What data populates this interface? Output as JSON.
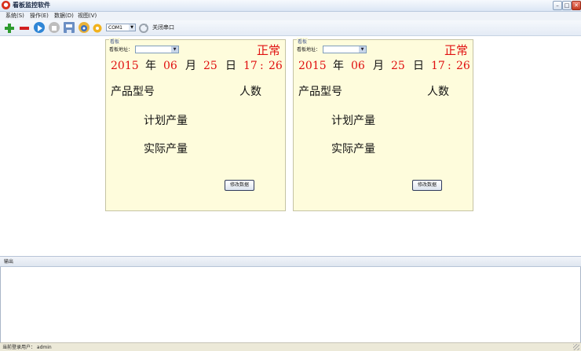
{
  "window": {
    "title": "看板监控软件",
    "app_icon": "app-logo-icon"
  },
  "menu": [
    "系统(S)",
    "操作(E)",
    "数据(D)",
    "视图(V)"
  ],
  "toolbar": {
    "port_value": "COM1",
    "close_port_label": "关闭串口",
    "icons": [
      "add-icon",
      "remove-icon",
      "play-icon",
      "stop-icon",
      "save-icon",
      "compass-icon",
      "settings-icon",
      "refresh-icon"
    ]
  },
  "panels": [
    {
      "header": "看板",
      "address_label": "看板地址：",
      "address_value": "",
      "status": "正常",
      "year": "2015",
      "year_unit": "年",
      "month": "06",
      "month_unit": "月",
      "day": "25",
      "day_unit": "日",
      "hour": "17",
      "sep": ":",
      "minute": "26",
      "product_model_label": "产品型号",
      "people_label": "人数",
      "planned_label": "计划产量",
      "actual_label": "实际产量",
      "edit_button": "修改数据"
    },
    {
      "header": "看板",
      "address_label": "看板地址：",
      "address_value": "",
      "status": "正常",
      "year": "2015",
      "year_unit": "年",
      "month": "06",
      "month_unit": "月",
      "day": "25",
      "day_unit": "日",
      "hour": "17",
      "sep": ":",
      "minute": "26",
      "product_model_label": "产品型号",
      "people_label": "人数",
      "planned_label": "计划产量",
      "actual_label": "实际产量",
      "edit_button": "修改数据"
    }
  ],
  "output": {
    "title": "输出"
  },
  "statusbar": {
    "text": "当前登录用户： admin"
  },
  "colors": {
    "accent_red": "#e01010",
    "panel_bg": "#fefcdc"
  }
}
